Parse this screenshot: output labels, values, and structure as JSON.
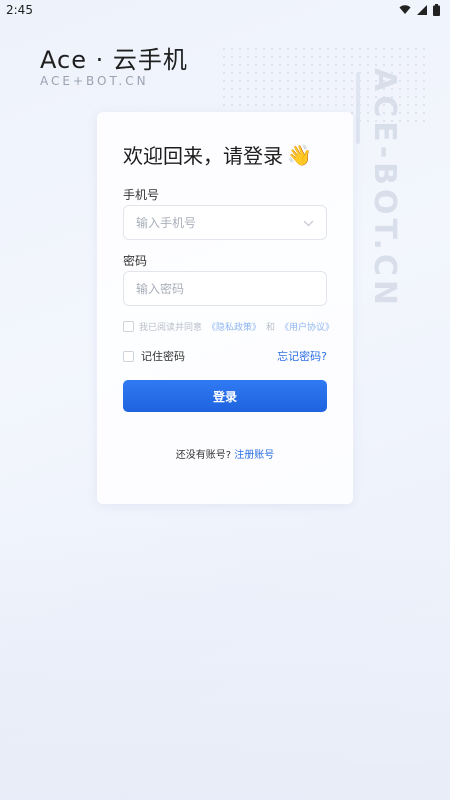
{
  "status_bar": {
    "time": "2:45",
    "icons": [
      "wifi-icon",
      "signal-icon",
      "battery-icon"
    ]
  },
  "brand": {
    "title": "Ace · 云手机",
    "subtitle": "ACE+BOT.CN",
    "watermark": "ACE-BOT.CN"
  },
  "login": {
    "welcome": "欢迎回来，请登录",
    "wave_emoji": "👋",
    "phone_label": "手机号",
    "phone_placeholder": "输入手机号",
    "password_label": "密码",
    "password_placeholder": "输入密码",
    "agree_prefix": "我已阅读并同意",
    "privacy_link": "《隐私政策》",
    "agree_and": "和",
    "terms_link": "《用户协议》",
    "remember_label": "记住密码",
    "forgot_link": "忘记密码?",
    "login_button": "登录",
    "no_account_text": "还没有账号?",
    "register_link": "注册账号"
  },
  "colors": {
    "accent": "#1f63df",
    "link": "#2b6fe3",
    "background": "#eef2fb"
  }
}
